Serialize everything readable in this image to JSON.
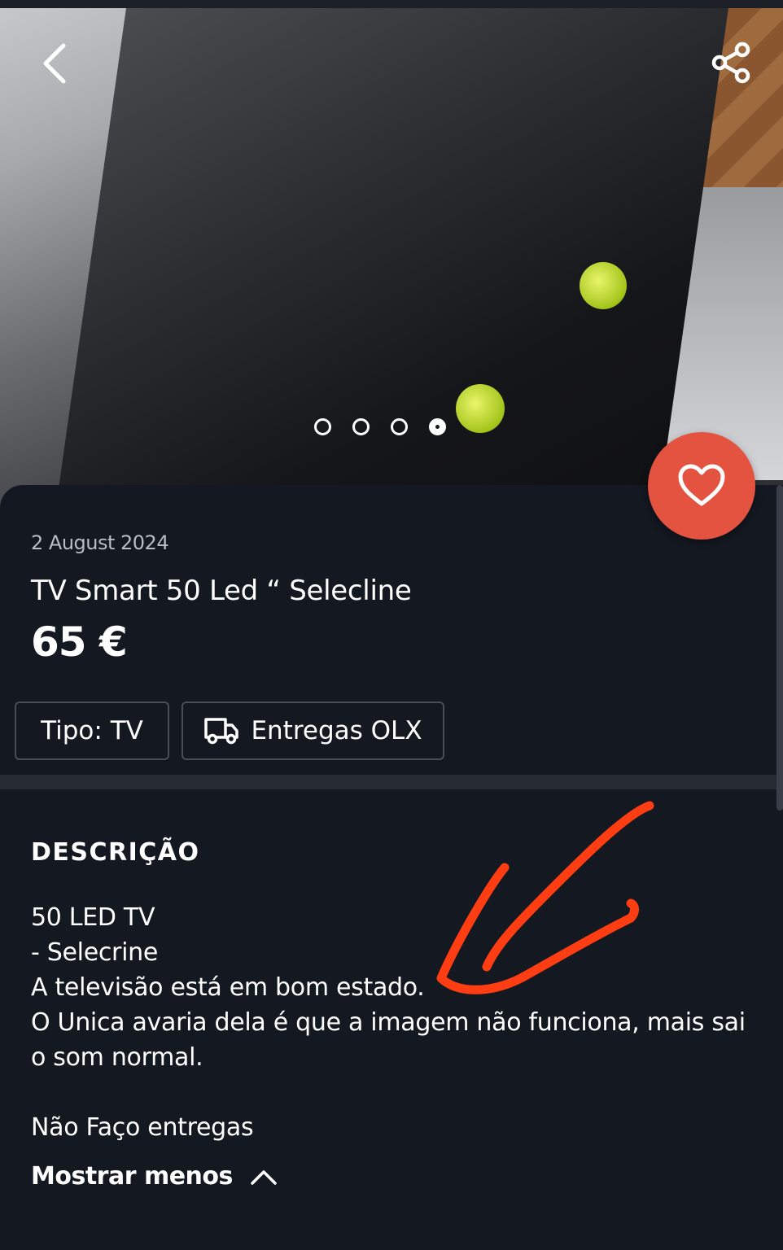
{
  "gallery": {
    "image_count": 4,
    "active_index": 3,
    "icons": {
      "back": "chevron-left-icon",
      "share": "share-icon",
      "favorite": "heart-icon"
    }
  },
  "listing": {
    "date": "2 August 2024",
    "title": "TV Smart 50 Led “ Selecline",
    "price": "65 €"
  },
  "chips": {
    "type": "Tipo: TV",
    "delivery": "Entregas OLX",
    "delivery_icon": "truck-icon"
  },
  "description": {
    "heading": "DESCRIÇÃO",
    "lines": [
      "50 LED TV",
      "- Selecrine",
      "A televisão está em bom estado.",
      "O Unica avaria dela é que a imagem não funciona, mais sai o som normal.",
      "",
      "Não Faço entregas"
    ],
    "toggle_label": "Mostrar menos",
    "toggle_icon": "chevron-up-icon"
  },
  "colors": {
    "background": "#141821",
    "favorite_button": "#e3533f",
    "annotation_arrow": "#ff3d12"
  }
}
